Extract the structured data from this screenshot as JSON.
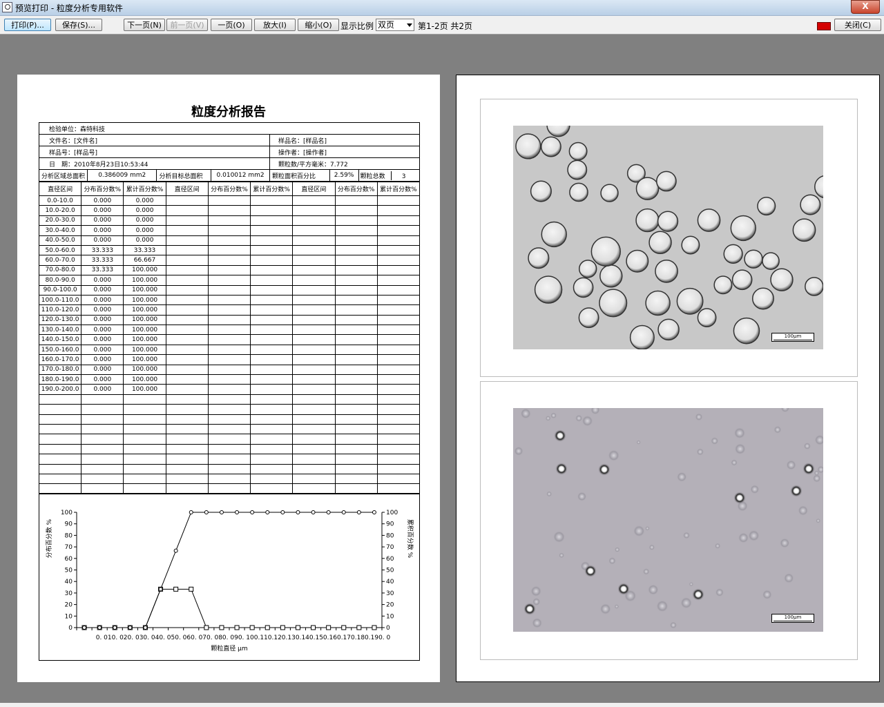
{
  "window": {
    "title": "预览打印 - 粒度分析专用软件",
    "close_label": "X"
  },
  "toolbar": {
    "print": "打印(P)...",
    "save": "保存(S)...",
    "next_page": "下一页(N)",
    "prev_page": "前一页(V)",
    "one_page": "一页(O)",
    "zoom_in": "放大(I)",
    "zoom_out": "缩小(O)",
    "display_ratio_label": "显示比例",
    "display_ratio_value": "双页",
    "page_info": "第1-2页 共2页",
    "close": "关闭(C)"
  },
  "report": {
    "title": "粒度分析报告",
    "unit": "检验单位：森特科技",
    "file_name": "文件名：[文件名]",
    "sample_name": "样品名：[样品名]",
    "sample_no": "样品号：[样品号]",
    "operator": "操作者：[操作者]",
    "date": "日　期：2010年8月23日10:53:44",
    "density": "颗粒数/平方毫米：7.772",
    "area_total_label": "分析区域总面积",
    "area_total_value": "0.386009 mm2",
    "target_area_label": "分析目标总面积",
    "target_area_value": "0.010012 mm2",
    "area_pct_label": "颗粒面积百分比",
    "area_pct_value": "2.59%",
    "count_label": "颗粒总数",
    "count_value": "3",
    "col_headers": [
      "直径区间",
      "分布百分数%",
      "累计百分数%",
      "直径区间",
      "分布百分数%",
      "累计百分数%",
      "直径区间",
      "分布百分数%",
      "累计百分数%"
    ],
    "rows": [
      [
        "0.0-10.0",
        "0.000",
        "0.000"
      ],
      [
        "10.0-20.0",
        "0.000",
        "0.000"
      ],
      [
        "20.0-30.0",
        "0.000",
        "0.000"
      ],
      [
        "30.0-40.0",
        "0.000",
        "0.000"
      ],
      [
        "40.0-50.0",
        "0.000",
        "0.000"
      ],
      [
        "50.0-60.0",
        "33.333",
        "33.333"
      ],
      [
        "60.0-70.0",
        "33.333",
        "66.667"
      ],
      [
        "70.0-80.0",
        "33.333",
        "100.000"
      ],
      [
        "80.0-90.0",
        "0.000",
        "100.000"
      ],
      [
        "90.0-100.0",
        "0.000",
        "100.000"
      ],
      [
        "100.0-110.0",
        "0.000",
        "100.000"
      ],
      [
        "110.0-120.0",
        "0.000",
        "100.000"
      ],
      [
        "120.0-130.0",
        "0.000",
        "100.000"
      ],
      [
        "130.0-140.0",
        "0.000",
        "100.000"
      ],
      [
        "140.0-150.0",
        "0.000",
        "100.000"
      ],
      [
        "150.0-160.0",
        "0.000",
        "100.000"
      ],
      [
        "160.0-170.0",
        "0.000",
        "100.000"
      ],
      [
        "170.0-180.0",
        "0.000",
        "100.000"
      ],
      [
        "180.0-190.0",
        "0.000",
        "100.000"
      ],
      [
        "190.0-200.0",
        "0.000",
        "100.000"
      ]
    ],
    "empty_rows": 10
  },
  "chart_data": {
    "type": "line",
    "xlabel": "颗粒直径 μm",
    "ylabel_left": "分布百分数 %",
    "ylabel_right": "累积百分数 %",
    "ylim": [
      0,
      100
    ],
    "yticks": [
      0,
      10,
      20,
      30,
      40,
      50,
      60,
      70,
      80,
      90,
      100
    ],
    "x_tick_text": "0. 010. 020. 030. 040. 050. 060. 070. 080. 090. 100.110.120.130.140.150.160.170.180.190. 0",
    "x": [
      5,
      15,
      25,
      35,
      45,
      55,
      65,
      75,
      85,
      95,
      105,
      115,
      125,
      135,
      145,
      155,
      165,
      175,
      185,
      195
    ],
    "series": [
      {
        "marker": "square",
        "values": [
          0,
          0,
          0,
          0,
          0,
          33.333,
          33.333,
          33.333,
          0,
          0,
          0,
          0,
          0,
          0,
          0,
          0,
          0,
          0,
          0,
          0
        ]
      },
      {
        "marker": "circle",
        "values": [
          0,
          0,
          0,
          0,
          0,
          33.333,
          66.667,
          100,
          100,
          100,
          100,
          100,
          100,
          100,
          100,
          100,
          100,
          100,
          100,
          100
        ]
      }
    ]
  },
  "images": {
    "scale_bar_top": "100μm",
    "scale_bar_bottom": "100μm"
  }
}
